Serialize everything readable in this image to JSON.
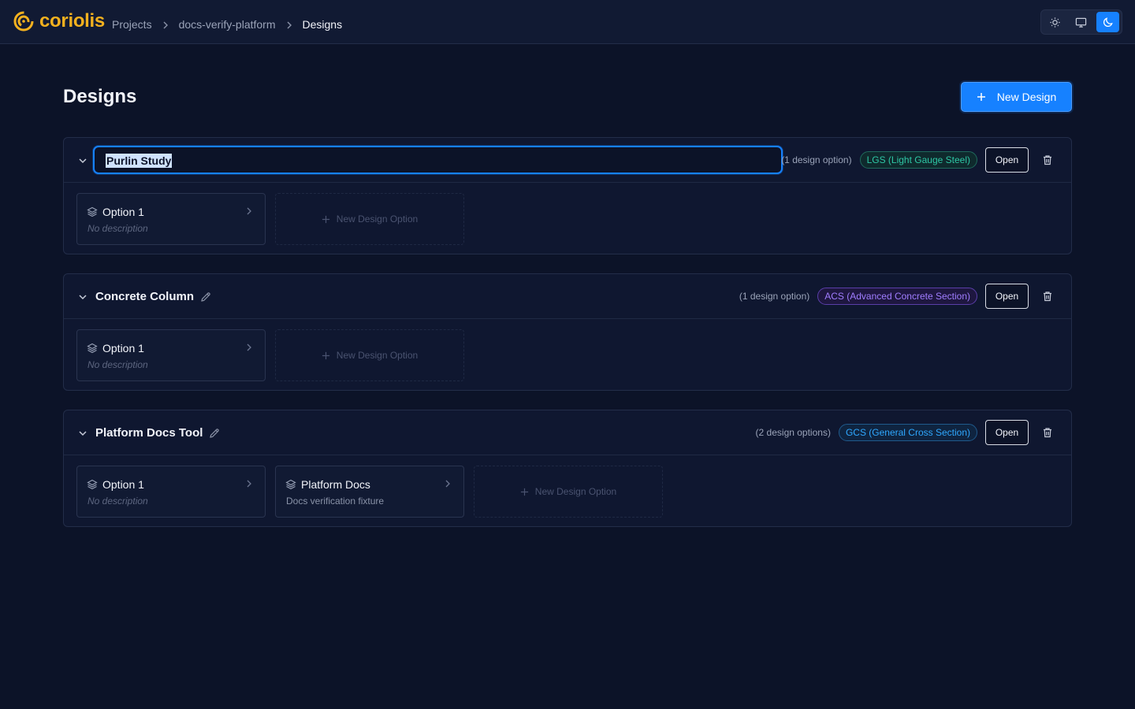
{
  "header": {
    "logo_text": "coriolis",
    "breadcrumbs": [
      "Projects",
      "docs-verify-platform",
      "Designs"
    ],
    "theme_options": [
      "light-theme",
      "system-theme",
      "dark-theme"
    ],
    "active_theme": "dark-theme"
  },
  "page": {
    "title": "Designs",
    "new_design_label": "New Design"
  },
  "colors": {
    "accent": "#1681ff",
    "logo": "#f3b11f",
    "background": "#0c1328"
  },
  "designs": [
    {
      "name": "Purlin Study",
      "editing": true,
      "count_label": "(1 design option)",
      "badge": "LGS (Light Gauge Steel)",
      "open_label": "Open",
      "options": [
        {
          "title": "Option 1",
          "description": "No description"
        }
      ],
      "new_option_label": "New Design Option"
    },
    {
      "name": "Concrete Column",
      "editing": false,
      "count_label": "(1 design option)",
      "badge": "ACS (Advanced Concrete Section)",
      "open_label": "Open",
      "options": [
        {
          "title": "Option 1",
          "description": "No description"
        }
      ],
      "new_option_label": "New Design Option"
    },
    {
      "name": "Platform Docs Tool",
      "editing": false,
      "count_label": "(2 design options)",
      "badge": "GCS (General Cross Section)",
      "open_label": "Open",
      "options": [
        {
          "title": "Option 1",
          "description": "No description"
        },
        {
          "title": "Platform Docs",
          "description": "Docs verification fixture"
        }
      ],
      "new_option_label": "New Design Option"
    }
  ]
}
